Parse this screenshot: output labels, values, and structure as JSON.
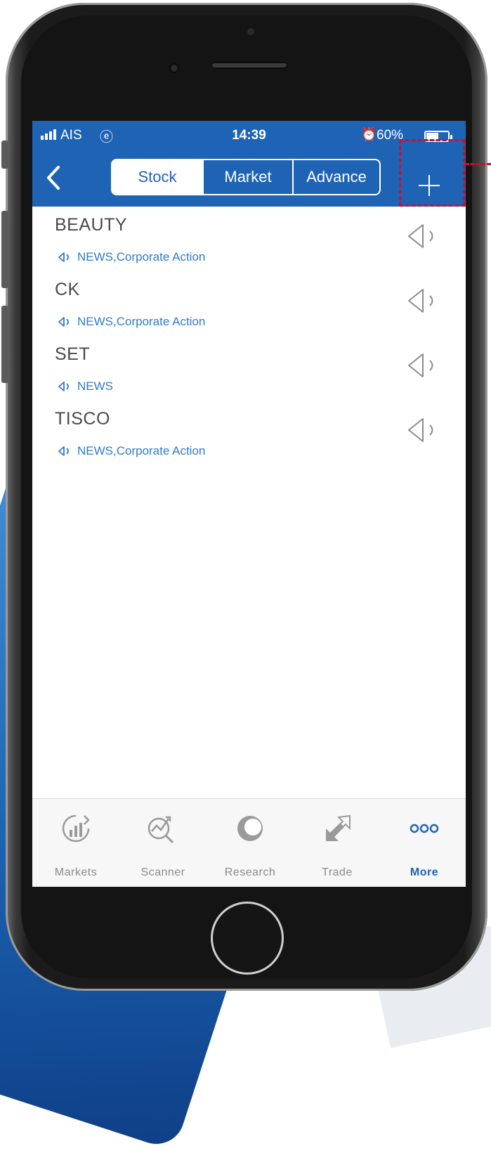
{
  "status_bar": {
    "carrier": "AIS",
    "time": "14:39",
    "battery_pct_text": "60%",
    "battery_level": 0.6
  },
  "nav": {
    "tabs": [
      {
        "label": "Stock",
        "active": true
      },
      {
        "label": "Market",
        "active": false
      },
      {
        "label": "Advance",
        "active": false
      }
    ],
    "add_label": "+"
  },
  "alerts": [
    {
      "symbol": "BEAUTY",
      "types": "NEWS,Corporate Action"
    },
    {
      "symbol": "CK",
      "types": "NEWS,Corporate Action"
    },
    {
      "symbol": "SET",
      "types": "NEWS"
    },
    {
      "symbol": "TISCO",
      "types": "NEWS,Corporate Action"
    }
  ],
  "tabbar": [
    {
      "label": "Markets",
      "icon": "markets-icon",
      "active": false
    },
    {
      "label": "Scanner",
      "icon": "scanner-icon",
      "active": false
    },
    {
      "label": "Research",
      "icon": "research-icon",
      "active": false
    },
    {
      "label": "Trade",
      "icon": "trade-icon",
      "active": false
    },
    {
      "label": "More",
      "icon": "more-icon",
      "active": true
    }
  ],
  "colors": {
    "brand_blue": "#1f63b5",
    "link_blue": "#2f7ad0",
    "highlight_red": "#c8102e"
  }
}
